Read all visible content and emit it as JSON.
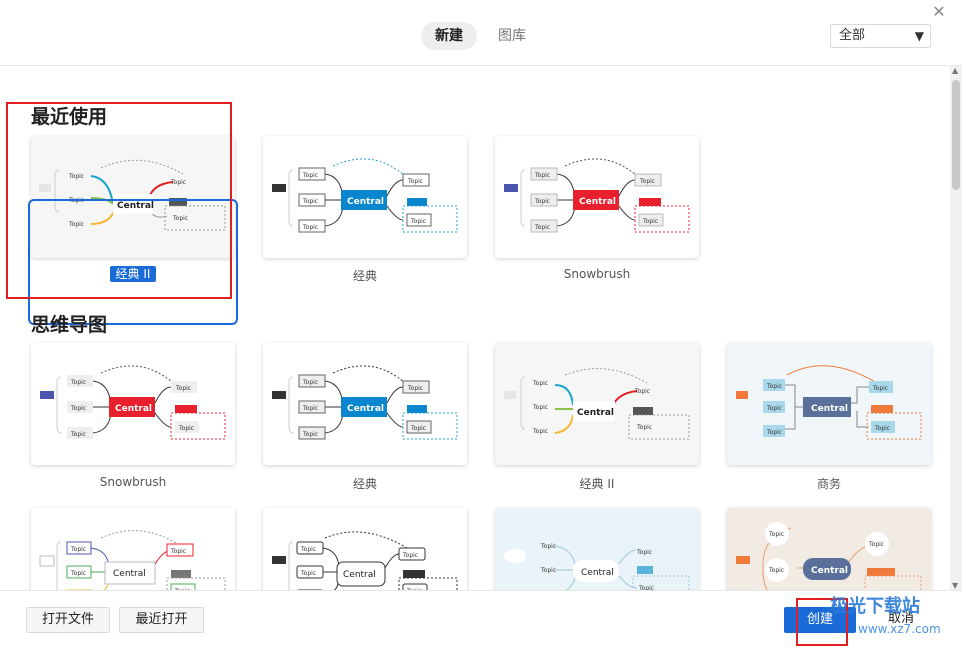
{
  "tabs": {
    "new_label": "新建",
    "library_label": "图库"
  },
  "filter": {
    "selected": "全部"
  },
  "sections": {
    "recent_title": "最近使用",
    "mindmap_title": "思维导图"
  },
  "recent_cards": [
    {
      "label": "经典 II",
      "selected": true
    },
    {
      "label": "经典"
    },
    {
      "label": "Snowbrush"
    }
  ],
  "mindmap_cards": [
    {
      "label": "Snowbrush"
    },
    {
      "label": "经典"
    },
    {
      "label": "经典 II"
    },
    {
      "label": "商务"
    }
  ],
  "thumb_text": {
    "topic": "Topic",
    "central": "Central",
    "subtopic": "Topic"
  },
  "footer": {
    "open_file": "打开文件",
    "recent_open": "最近打开",
    "create": "创建",
    "cancel": "取消"
  },
  "watermark": {
    "name": "极光下载站",
    "url": "www.xz7.com"
  },
  "colors": {
    "accent": "#1a6ad8",
    "highlight_red": "#e02020",
    "central_blue": "#0a86cf",
    "central_red": "#e8202e",
    "business_navy": "#5a6f9a"
  }
}
